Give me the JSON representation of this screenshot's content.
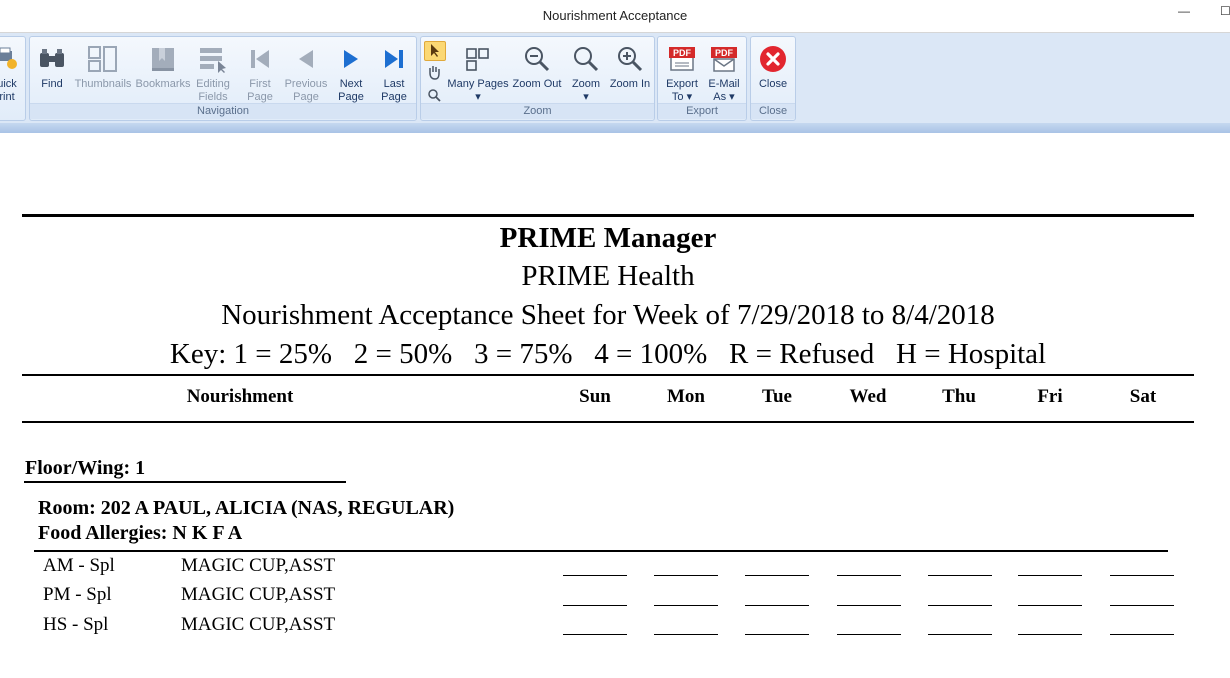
{
  "window": {
    "title": "Nourishment Acceptance",
    "min_glyph": "—",
    "max_glyph": "☐"
  },
  "ribbon": {
    "quick_print": {
      "label": "uick\nrint"
    },
    "navigation": {
      "group_label": "Navigation",
      "buttons": [
        {
          "label": "Find",
          "icon": "binoculars-icon",
          "enabled": true
        },
        {
          "label": "Thumbnails",
          "icon": "thumbnails-icon",
          "enabled": false
        },
        {
          "label": "Bookmarks",
          "icon": "bookmark-icon",
          "enabled": false
        },
        {
          "label": "Editing\nFields",
          "icon": "editing-fields-icon",
          "enabled": false
        },
        {
          "label": "First\nPage",
          "icon": "first-page-icon",
          "enabled": false
        },
        {
          "label": "Previous\nPage",
          "icon": "previous-page-icon",
          "enabled": false
        },
        {
          "label": "Next\nPage",
          "icon": "next-page-icon",
          "enabled": true
        },
        {
          "label": "Last\nPage",
          "icon": "last-page-icon",
          "enabled": true
        }
      ]
    },
    "zoom": {
      "group_label": "Zoom",
      "buttons": [
        {
          "label": "Many Pages\n▾",
          "icon": "many-pages-icon"
        },
        {
          "label": "Zoom Out",
          "icon": "zoom-out-icon"
        },
        {
          "label": "Zoom\n▾",
          "icon": "zoom-icon"
        },
        {
          "label": "Zoom In",
          "icon": "zoom-in-icon"
        }
      ]
    },
    "export": {
      "group_label": "Export",
      "buttons": [
        {
          "label": "Export\nTo ▾",
          "icon": "pdf-export-icon"
        },
        {
          "label": "E-Mail\nAs ▾",
          "icon": "pdf-email-icon"
        }
      ]
    },
    "close": {
      "group_label": "Close",
      "label": "Close",
      "icon": "close-icon"
    },
    "colors": {
      "ribbon_bg": "#dbe7f6",
      "text": "#1f3a66",
      "close_red": "#e2262f",
      "pdf_red": "#d42a2a"
    }
  },
  "report": {
    "company": "PRIME Manager",
    "facility": "PRIME Health",
    "sheet_title": "Nourishment Acceptance Sheet for Week of 7/29/2018 to 8/4/2018",
    "key": "Key: 1 = 25%   2 = 50%   3 = 75%   4 = 100%   R = Refused   H = Hospital",
    "columns": {
      "nourishment": "Nourishment",
      "days": [
        "Sun",
        "Mon",
        "Tue",
        "Wed",
        "Thu",
        "Fri",
        "Sat"
      ]
    },
    "floor_wing": "Floor/Wing: 1",
    "room_line": "Room: 202 A PAUL, ALICIA (NAS, REGULAR)",
    "allergies": "Food Allergies: N K F A",
    "rows": [
      {
        "time": "AM - Spl",
        "item": "MAGIC CUP,ASST"
      },
      {
        "time": "PM - Spl",
        "item": "MAGIC CUP,ASST"
      },
      {
        "time": "HS - Spl",
        "item": "MAGIC CUP,ASST"
      }
    ]
  }
}
